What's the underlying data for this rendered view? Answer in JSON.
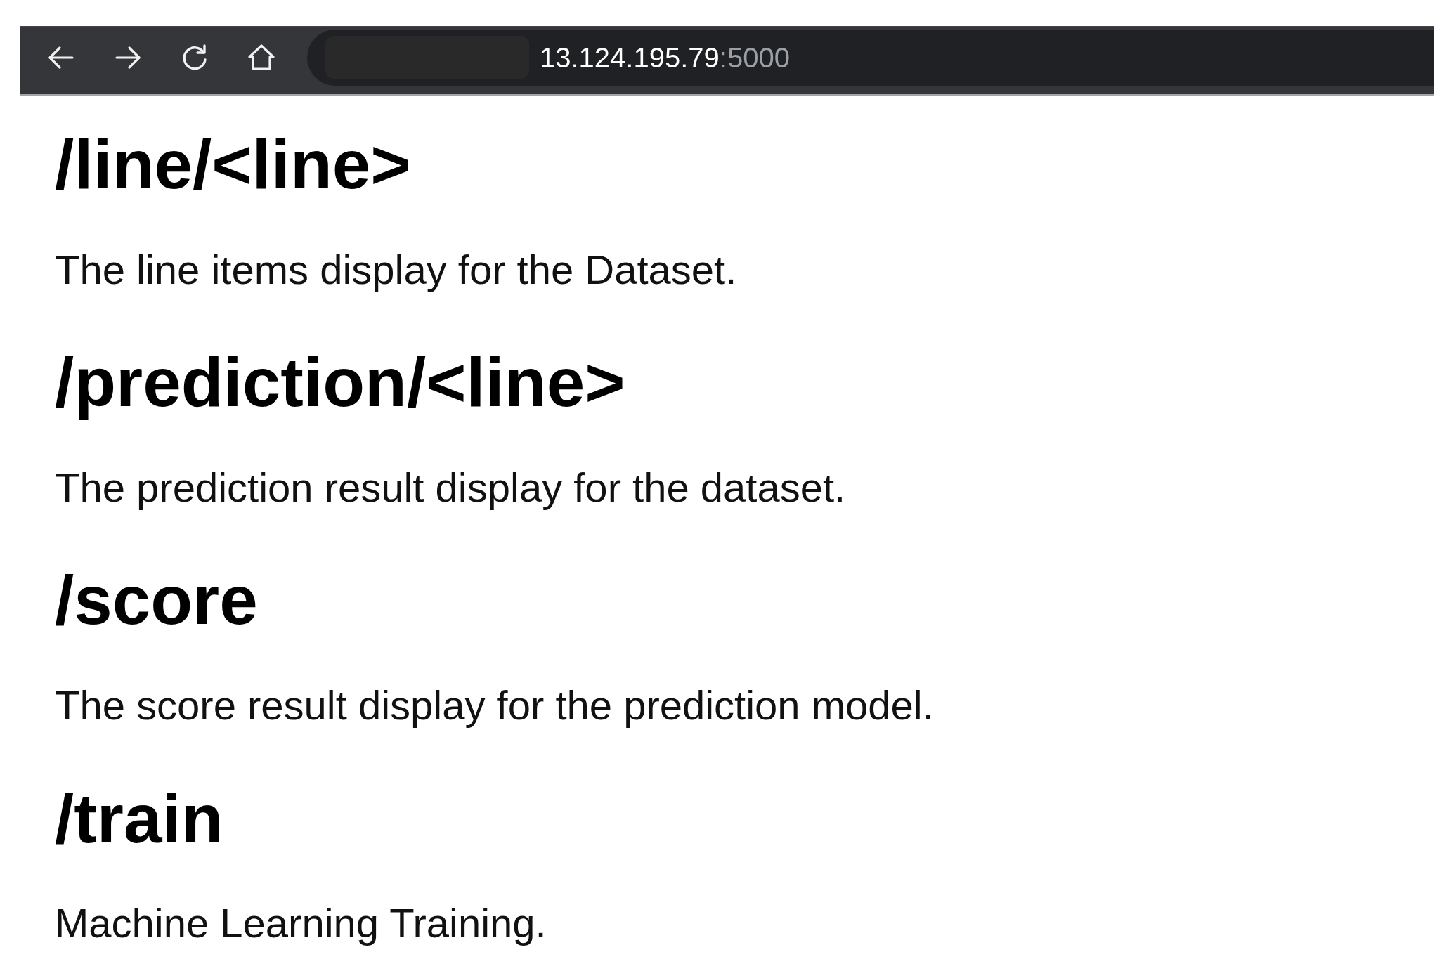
{
  "browser_toolbar": {
    "address": {
      "host": "13.124.195.79",
      "port": ":5000"
    }
  },
  "sections": [
    {
      "heading": "/line/<line>",
      "text": "The line items display for the Dataset."
    },
    {
      "heading": "/prediction/<line>",
      "text": "The prediction result display for the dataset."
    },
    {
      "heading": "/score",
      "text": "The score result display for the prediction model."
    },
    {
      "heading": "/train",
      "text": "Machine Learning Training."
    }
  ]
}
